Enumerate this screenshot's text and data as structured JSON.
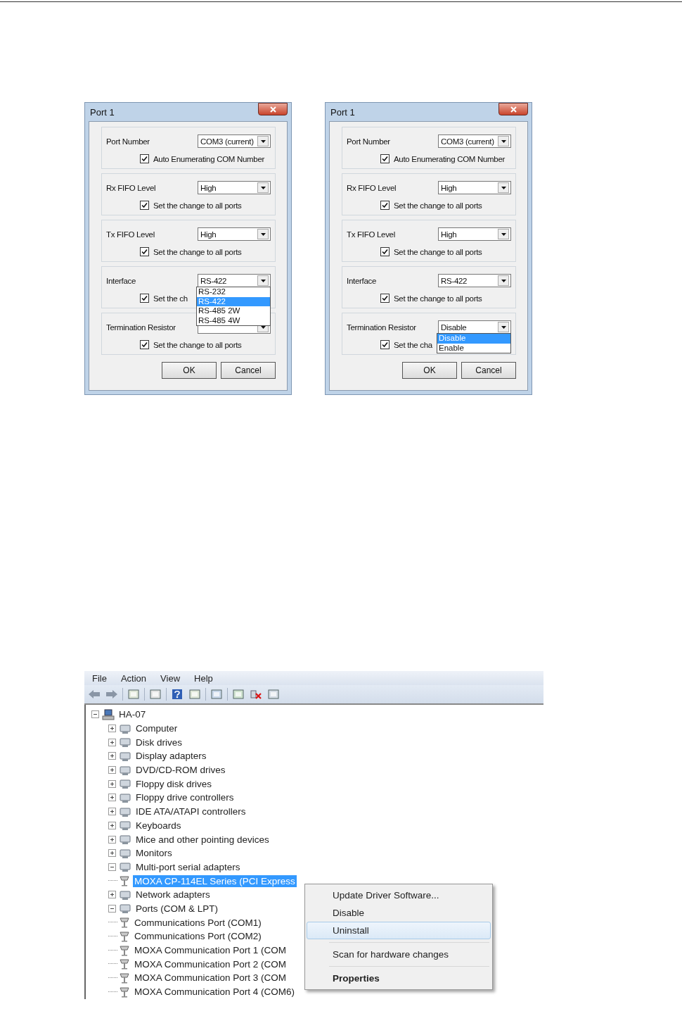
{
  "dialogs": [
    {
      "title": "Port 1",
      "groups": [
        {
          "label": "Port Number",
          "combo": {
            "value": "COM3 (current)"
          },
          "checkbox": {
            "label": "Auto Enumerating COM Number",
            "checked": true
          }
        },
        {
          "label": "Rx FIFO Level",
          "combo": {
            "value": "High"
          },
          "checkbox": {
            "label": "Set the change to all ports",
            "checked": true
          }
        },
        {
          "label": "Tx FIFO Level",
          "combo": {
            "value": "High"
          },
          "checkbox": {
            "label": "Set the change to all ports",
            "checked": true
          }
        },
        {
          "label": "Interface",
          "combo": {
            "value": "RS-422"
          },
          "checkbox": {
            "label": "Set the ch",
            "checked": true
          },
          "dropdown": [
            {
              "label": "RS-232",
              "selected": false
            },
            {
              "label": "RS-422",
              "selected": true
            },
            {
              "label": "RS-485 2W",
              "selected": false
            },
            {
              "label": "RS-485 4W",
              "selected": false
            }
          ]
        },
        {
          "label": "Termination Resistor",
          "checkbox": {
            "label": "Set the change to all ports",
            "checked": true
          }
        }
      ],
      "buttons": [
        "OK",
        "Cancel"
      ]
    },
    {
      "title": "Port 1",
      "groups": [
        {
          "label": "Port Number",
          "combo": {
            "value": "COM3 (current)"
          },
          "checkbox": {
            "label": "Auto Enumerating COM Number",
            "checked": true
          }
        },
        {
          "label": "Rx FIFO Level",
          "combo": {
            "value": "High"
          },
          "checkbox": {
            "label": "Set the change to all ports",
            "checked": true
          }
        },
        {
          "label": "Tx FIFO Level",
          "combo": {
            "value": "High"
          },
          "checkbox": {
            "label": "Set the change to all ports",
            "checked": true
          }
        },
        {
          "label": "Interface",
          "combo": {
            "value": "RS-422"
          },
          "checkbox": {
            "label": "Set the change to all ports",
            "checked": true
          }
        },
        {
          "label": "Termination Resistor",
          "combo": {
            "value": "Disable"
          },
          "checkbox": {
            "label": "Set the cha",
            "checked": true
          },
          "dropdown": [
            {
              "label": "Disable",
              "selected": true
            },
            {
              "label": "Enable",
              "selected": false
            }
          ]
        }
      ],
      "buttons": [
        "OK",
        "Cancel"
      ]
    }
  ],
  "device_manager": {
    "menu": [
      "File",
      "Action",
      "View",
      "Help"
    ],
    "tree": {
      "label": "HA-07",
      "expanded": true,
      "children": [
        {
          "label": "Computer",
          "expanded": false
        },
        {
          "label": "Disk drives",
          "expanded": false
        },
        {
          "label": "Display adapters",
          "expanded": false
        },
        {
          "label": "DVD/CD-ROM drives",
          "expanded": false
        },
        {
          "label": "Floppy disk drives",
          "expanded": false
        },
        {
          "label": "Floppy drive controllers",
          "expanded": false
        },
        {
          "label": "IDE ATA/ATAPI controllers",
          "expanded": false
        },
        {
          "label": "Keyboards",
          "expanded": false
        },
        {
          "label": "Mice and other pointing devices",
          "expanded": false
        },
        {
          "label": "Monitors",
          "expanded": false
        },
        {
          "label": "Multi-port serial adapters",
          "expanded": true,
          "children": [
            {
              "label": "MOXA CP-114EL Series (PCI Express",
              "selected": true
            }
          ]
        },
        {
          "label": "Network adapters",
          "expanded": false
        },
        {
          "label": "Ports (COM & LPT)",
          "expanded": true,
          "children": [
            {
              "label": "Communications Port (COM1)",
              "selected": false
            },
            {
              "label": "Communications Port (COM2)",
              "selected": false
            },
            {
              "label": "MOXA Communication Port 1 (COM",
              "selected": false
            },
            {
              "label": "MOXA Communication Port 2 (COM",
              "selected": false
            },
            {
              "label": "MOXA Communication Port 3 (COM",
              "selected": false
            },
            {
              "label": "MOXA Communication Port 4 (COM6)",
              "selected": false
            }
          ]
        }
      ]
    },
    "context_menu": [
      {
        "kind": "item",
        "label": "Update Driver Software...",
        "selected": false,
        "default": false
      },
      {
        "kind": "item",
        "label": "Disable",
        "selected": false,
        "default": false
      },
      {
        "kind": "item",
        "label": "Uninstall",
        "selected": true,
        "default": false
      },
      {
        "kind": "separator"
      },
      {
        "kind": "item",
        "label": "Scan for hardware changes",
        "selected": false,
        "default": false
      },
      {
        "kind": "separator"
      },
      {
        "kind": "item",
        "label": "Properties",
        "selected": false,
        "default": true
      }
    ]
  }
}
